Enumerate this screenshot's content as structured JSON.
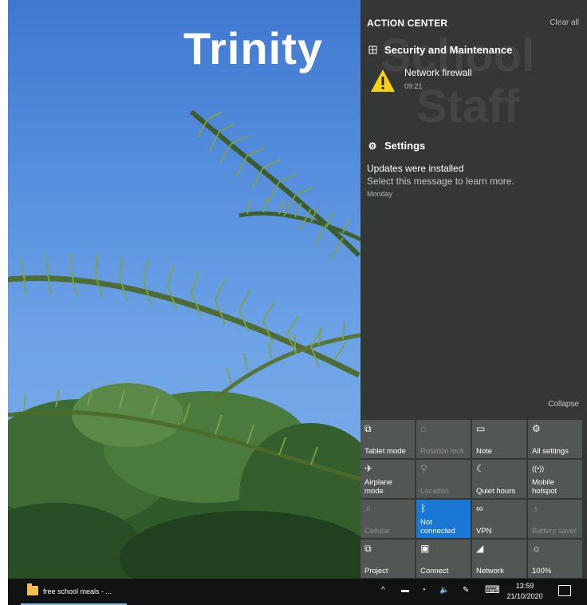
{
  "wallpaper": {
    "title": "Trinity"
  },
  "action_center": {
    "background_text": [
      "School",
      "Staff"
    ],
    "header": "ACTION CENTER",
    "clear_all": "Clear all",
    "groups": [
      {
        "title": "Security and Maintenance",
        "icon": "flag-icon",
        "notifications": [
          {
            "title": "Network firewall",
            "time": "09:21",
            "icon": "warning-icon"
          }
        ]
      },
      {
        "title": "Settings",
        "icon": "gear-icon",
        "notifications": [
          {
            "title": "Updates were installed",
            "body": "Select this message to learn more.",
            "time": "Monday"
          }
        ]
      }
    ],
    "collapse": "Collapse",
    "quick_actions": [
      {
        "label": "Tablet mode",
        "icon": "tablet-mode-icon",
        "glyph": "⧉",
        "state": "off"
      },
      {
        "label": "Rotation lock",
        "icon": "rotation-lock-icon",
        "glyph": "⌂",
        "state": "disabled"
      },
      {
        "label": "Note",
        "icon": "note-icon",
        "glyph": "▭",
        "state": "off"
      },
      {
        "label": "All settings",
        "icon": "settings-icon",
        "glyph": "⚙",
        "state": "off"
      },
      {
        "label": "Airplane mode",
        "icon": "airplane-icon",
        "glyph": "✈",
        "state": "off"
      },
      {
        "label": "Location",
        "icon": "location-icon",
        "glyph": "⚲",
        "state": "disabled"
      },
      {
        "label": "Quiet hours",
        "icon": "moon-icon",
        "glyph": "☾",
        "state": "off"
      },
      {
        "label": "Mobile hotspot",
        "icon": "hotspot-icon",
        "glyph": "((•))",
        "state": "off"
      },
      {
        "label": "Cellular",
        "icon": "cellular-icon",
        "glyph": ".ıl",
        "state": "disabled"
      },
      {
        "label": "Not connected",
        "icon": "bluetooth-icon",
        "glyph": "ᛒ",
        "state": "active"
      },
      {
        "label": "VPN",
        "icon": "vpn-icon",
        "glyph": "∞",
        "state": "off"
      },
      {
        "label": "Battery saver",
        "icon": "battery-saver-icon",
        "glyph": "♁",
        "state": "disabled"
      },
      {
        "label": "Project",
        "icon": "project-icon",
        "glyph": "⧉",
        "state": "off"
      },
      {
        "label": "Connect",
        "icon": "connect-icon",
        "glyph": "▣",
        "state": "off"
      },
      {
        "label": "Network",
        "icon": "network-icon",
        "glyph": "◢",
        "state": "off"
      },
      {
        "label": "100%",
        "icon": "brightness-icon",
        "glyph": "☼",
        "state": "off"
      }
    ]
  },
  "taskbar": {
    "app_label": "free school meals - ...",
    "tray": {
      "chevron": "^",
      "battery": "▬",
      "wifi": "◔",
      "volume": "🔈",
      "pen": "✎",
      "keyboard": "⌨"
    },
    "clock": {
      "time": "13:59",
      "date": "21/10/2020"
    }
  },
  "colors": {
    "accent": "#1a78d4",
    "panel": "#262826",
    "warning": "#f5d211"
  }
}
